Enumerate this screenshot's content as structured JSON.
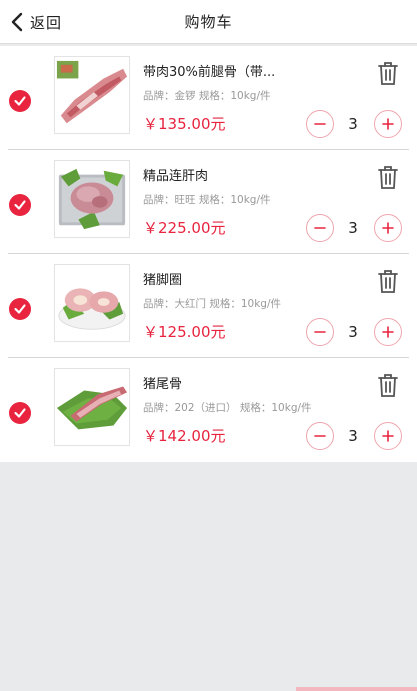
{
  "header": {
    "back_label": "返回",
    "title": "购物车"
  },
  "items": [
    {
      "name": "带肉30%前腿骨（带...",
      "meta": "品牌：金锣 规格：10kg/件",
      "price": "￥135.00元",
      "quantity": "3",
      "checked": true
    },
    {
      "name": "精品连肝肉",
      "meta": "品牌：旺旺 规格：10kg/件",
      "price": "￥225.00元",
      "quantity": "3",
      "checked": true
    },
    {
      "name": "猪脚圈",
      "meta": "品牌：大红门 规格：10kg/件",
      "price": "￥125.00元",
      "quantity": "3",
      "checked": true
    },
    {
      "name": "猪尾骨",
      "meta": "品牌：202（进口） 规格：10kg/件",
      "price": "￥142.00元",
      "quantity": "3",
      "checked": true
    }
  ],
  "colors": {
    "accent": "#e8243f",
    "accent_light": "#f0a6b0",
    "background": "#e9eaeb"
  }
}
